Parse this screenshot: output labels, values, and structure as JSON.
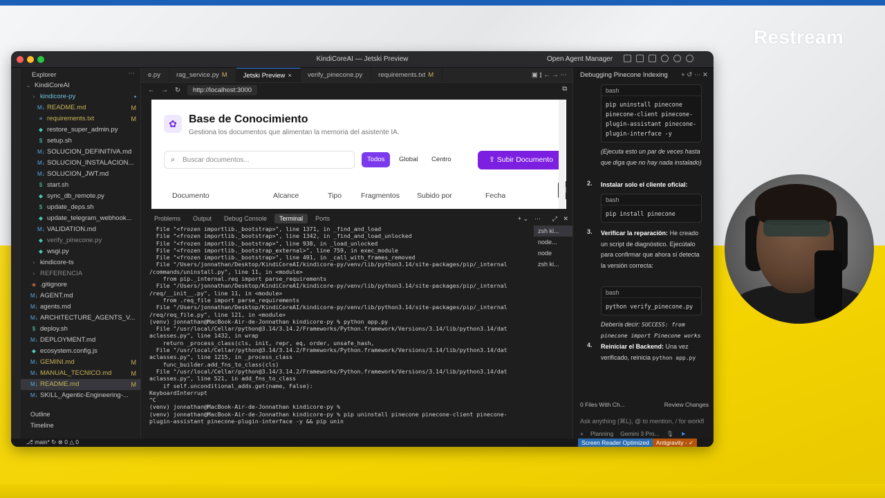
{
  "brand": "Restream",
  "window": {
    "title": "KindiCoreAI — Jetski Preview",
    "agent_manager": "Open Agent Manager"
  },
  "explorer": {
    "title": "Explorer",
    "root": "KindiCoreAI",
    "items": [
      {
        "label": "kindicore-py",
        "indent": 1,
        "kind": "folder",
        "badge": "•",
        "color": "#6fc3df"
      },
      {
        "label": "README.md",
        "indent": 2,
        "kind": "md",
        "badge": "M",
        "color": "#c9b458"
      },
      {
        "label": "requirements.txt",
        "indent": 2,
        "kind": "txt",
        "badge": "M",
        "color": "#c9b458"
      },
      {
        "label": "restore_super_admin.py",
        "indent": 2,
        "kind": "py",
        "badge": "",
        "color": "#cccccc"
      },
      {
        "label": "setup.sh",
        "indent": 2,
        "kind": "sh",
        "badge": "",
        "color": "#cccccc"
      },
      {
        "label": "SOLUCION_DEFINITIVA.md",
        "indent": 2,
        "kind": "md",
        "badge": "",
        "color": "#cccccc"
      },
      {
        "label": "SOLUCION_INSTALACION...",
        "indent": 2,
        "kind": "md",
        "badge": "",
        "color": "#cccccc"
      },
      {
        "label": "SOLUCION_JWT.md",
        "indent": 2,
        "kind": "md",
        "badge": "",
        "color": "#cccccc"
      },
      {
        "label": "start.sh",
        "indent": 2,
        "kind": "sh",
        "badge": "",
        "color": "#cccccc"
      },
      {
        "label": "sync_db_remote.py",
        "indent": 2,
        "kind": "py",
        "badge": "",
        "color": "#cccccc"
      },
      {
        "label": "update_deps.sh",
        "indent": 2,
        "kind": "sh",
        "badge": "",
        "color": "#cccccc"
      },
      {
        "label": "update_telegram_webhook...",
        "indent": 2,
        "kind": "py",
        "badge": "",
        "color": "#cccccc"
      },
      {
        "label": "VALIDATION.md",
        "indent": 2,
        "kind": "md",
        "badge": "",
        "color": "#cccccc"
      },
      {
        "label": "verify_pinecone.py",
        "indent": 2,
        "kind": "py",
        "badge": "",
        "color": "#8a8a8a"
      },
      {
        "label": "wsgi.py",
        "indent": 2,
        "kind": "py",
        "badge": "",
        "color": "#cccccc"
      },
      {
        "label": "kindicore-ts",
        "indent": 1,
        "kind": "folder",
        "badge": "",
        "color": "#cccccc"
      },
      {
        "label": "REFERENCIA",
        "indent": 1,
        "kind": "folder",
        "badge": "",
        "color": "#8a8a8a"
      },
      {
        "label": ".gitignore",
        "indent": 1,
        "kind": "git",
        "badge": "",
        "color": "#cccccc"
      },
      {
        "label": "AGENT.md",
        "indent": 1,
        "kind": "md",
        "badge": "",
        "color": "#cccccc"
      },
      {
        "label": "agents.md",
        "indent": 1,
        "kind": "md",
        "badge": "",
        "color": "#cccccc"
      },
      {
        "label": "ARCHITECTURE_AGENTS_V...",
        "indent": 1,
        "kind": "md",
        "badge": "",
        "color": "#cccccc"
      },
      {
        "label": "deploy.sh",
        "indent": 1,
        "kind": "sh",
        "badge": "",
        "color": "#cccccc"
      },
      {
        "label": "DEPLOYMENT.md",
        "indent": 1,
        "kind": "md",
        "badge": "",
        "color": "#cccccc"
      },
      {
        "label": "ecosystem.config.js",
        "indent": 1,
        "kind": "js",
        "badge": "",
        "color": "#cccccc"
      },
      {
        "label": "GEMINI.md",
        "indent": 1,
        "kind": "md",
        "badge": "M",
        "color": "#c9b458"
      },
      {
        "label": "MANUAL_TECNICO.md",
        "indent": 1,
        "kind": "md",
        "badge": "M",
        "color": "#c9b458"
      },
      {
        "label": "README.md",
        "indent": 1,
        "kind": "md",
        "badge": "M",
        "color": "#c9b458",
        "selected": true
      },
      {
        "label": "SKILL_Agentic-Engineering-...",
        "indent": 1,
        "kind": "md",
        "badge": "",
        "color": "#cccccc"
      }
    ],
    "outline": "Outline",
    "timeline": "Timeline"
  },
  "tabs": [
    {
      "label": "e.py",
      "mod": ""
    },
    {
      "label": "rag_service.py",
      "mod": "M"
    },
    {
      "label": "Jetski Preview",
      "mod": "×",
      "active": true
    },
    {
      "label": "verify_pinecone.py",
      "mod": ""
    },
    {
      "label": "requirements.txt",
      "mod": "M"
    }
  ],
  "url": "http://localhost:3000",
  "preview": {
    "title": "Base de Conocimiento",
    "subtitle": "Gestiona los documentos que alimentan la memoria del asistente IA.",
    "search_placeholder": "Buscar documentos...",
    "filters": [
      "Todos",
      "Global",
      "Centro"
    ],
    "upload": "Subir Documento",
    "columns": [
      "Documento",
      "Alcance",
      "Tipo",
      "Fragmentos",
      "Subido por",
      "Fecha"
    ]
  },
  "panel_tabs": [
    "Problems",
    "Output",
    "Debug Console",
    "Terminal",
    "Ports"
  ],
  "terminal_lines": [
    "  File \"<frozen importlib._bootstrap>\", line 1371, in _find_and_load",
    "  File \"<frozen importlib._bootstrap>\", line 1342, in _find_and_load_unlocked",
    "  File \"<frozen importlib._bootstrap>\", line 938, in _load_unlocked",
    "  File \"<frozen importlib._bootstrap_external>\", line 759, in exec_module",
    "  File \"<frozen importlib._bootstrap>\", line 491, in _call_with_frames_removed",
    "  File \"/Users/jonnathan/Desktop/KindiCoreAI/kindicore-py/venv/lib/python3.14/site-packages/pip/_internal",
    "/commands/uninstall.py\", line 11, in <module>",
    "    from pip._internal.req import parse_requirements",
    "  File \"/Users/jonnathan/Desktop/KindiCoreAI/kindicore-py/venv/lib/python3.14/site-packages/pip/_internal",
    "/req/__init__.py\", line 11, in <module>",
    "    from .req_file import parse_requirements",
    "  File \"/Users/jonnathan/Desktop/KindiCoreAI/kindicore-py/venv/lib/python3.14/site-packages/pip/_internal",
    "/req/req_file.py\", line 121, in <module>",
    "(venv) jonnathan@MacBook-Air-de-Jonnathan kindicore-py % python app.py",
    "  File \"/usr/local/Cellar/python@3.14/3.14.2/Frameworks/Python.framework/Versions/3.14/lib/python3.14/dat",
    "aclasses.py\", line 1432, in wrap",
    "    return _process_class(cls, init, repr, eq, order, unsafe_hash,",
    "  File \"/usr/local/Cellar/python@3.14/3.14.2/Frameworks/Python.framework/Versions/3.14/lib/python3.14/dat",
    "aclasses.py\", line 1215, in _process_class",
    "    func_builder.add_fns_to_class(cls)",
    "  File \"/usr/local/Cellar/python@3.14/3.14.2/Frameworks/Python.framework/Versions/3.14/lib/python3.14/dat",
    "aclasses.py\", line 521, in add_fns_to_class",
    "    if self.unconditional_adds.get(name, False):",
    "KeyboardInterrupt",
    "^C",
    "(venv) jonnathan@MacBook-Air-de-Jonnathan kindicore-py %",
    "(venv) jonnathan@MacBook-Air-de-Jonnathan kindicore-py % pip uninstall pinecone pinecone-client pinecone-",
    "plugin-assistant pinecone-plugin-interface -y && pip unin"
  ],
  "terminal_sessions": [
    "zsh  ki...",
    "node...",
    "node",
    "zsh  ki..."
  ],
  "chat": {
    "header": "Debugging Pinecone Indexing",
    "block1_lang": "bash",
    "block1_code": [
      "pip uninstall pinecone",
      "pinecone-client pinecone-",
      "plugin-assistant pinecone-",
      "plugin-interface -y"
    ],
    "note": "(Ejecuta esto un par de veces hasta que diga que no hay nada instalado)",
    "step2_num": "2.",
    "step2": "Instalar solo el cliente oficial:",
    "block2_lang": "bash",
    "block2_code": "pip install pinecone",
    "step3_num": "3.",
    "step3_bold": "Verificar la reparación:",
    "step3_rest": " He creado un script de diagnóstico. Ejecútalo para confirmar que ahora sí detecta la versión correcta:",
    "block3_lang": "bash",
    "block3_code": "python verify_pinecone.py",
    "should_say": "Debería decir:",
    "should_say_code": "SUCCESS: from pinecone import Pinecone works",
    "step4_num": "4.",
    "step4_bold": "Reiniciar el Backend:",
    "step4_rest": " Una vez verificado, reinicia",
    "step4_code": "python app.py",
    "files_changed": "0 Files With Ch...",
    "review": "Review Changes",
    "ask_placeholder": "Ask anything (⌘L), @ to mention, / for workfl",
    "mode": "Planning",
    "model": "Gemini 3 Pro..."
  },
  "status": {
    "branch": "main*",
    "errors": "0",
    "warnings": "0",
    "screen_reader": "Screen Reader Optimized",
    "antigravity": "Antigravity - ✓"
  }
}
